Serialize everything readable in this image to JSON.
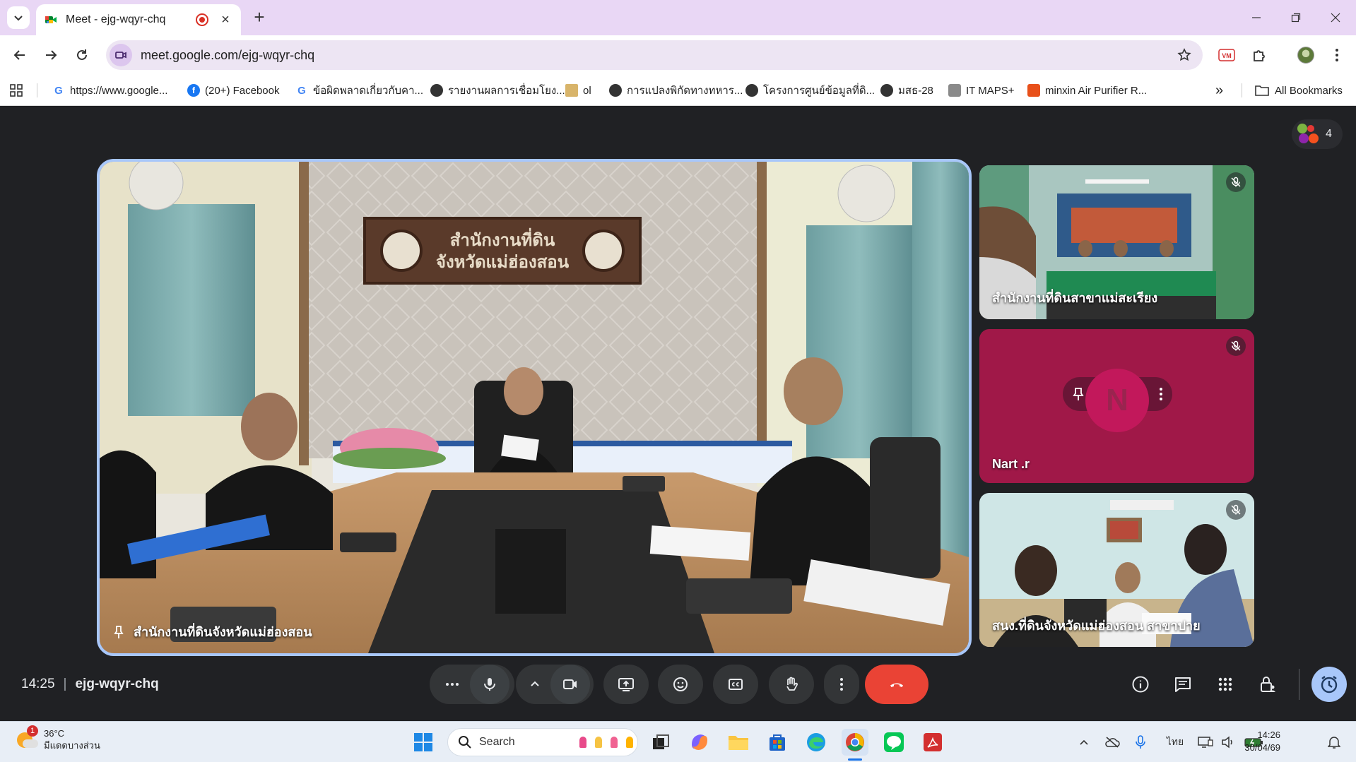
{
  "browser": {
    "tab_title": "Meet - ejg-wqyr-chq",
    "new_tab": "+",
    "close_tab": "×",
    "url": "meet.google.com/ejg-wqyr-chq",
    "bookmarks": [
      "https://www.google...",
      "(20+) Facebook",
      "ข้อผิดพลาดเกี่ยวกับคา...",
      "รายงานผลการเชื่อมโยง...",
      "ol",
      "การแปลงพิกัดทางทหาร...",
      "โครงการศูนย์ข้อมูลที่ดิ...",
      "มสธ-28",
      "IT MAPS+",
      "minxin Air Purifier R..."
    ],
    "more_bookmarks": "»",
    "all_bookmarks": "All Bookmarks"
  },
  "meet": {
    "participant_count": "4",
    "main_tile_label": "สำนักงานที่ดินจังหวัดแม่ฮ่องสอน",
    "sign_line1": "สำนักงานที่ดิน",
    "sign_line2": "จังหวัดแม่ฮ่องสอน",
    "tiles": [
      {
        "label": "สำนักงานที่ดินสาขาแม่สะเรียง",
        "muted": true
      },
      {
        "label": "Nart .r",
        "muted": true,
        "avatar_letter": "N",
        "avatar_color": "#c2185b"
      },
      {
        "label": "สนง.ที่ดินจังหวัดแม่ฮ่องสอน สาขาปาย",
        "muted": true
      }
    ],
    "time": "14:25",
    "meeting_code": "ejg-wqyr-chq",
    "leave_color": "#ea4335"
  },
  "taskbar": {
    "weather_temp": "36°C",
    "weather_desc": "มีแดดบางส่วน",
    "weather_badge": "1",
    "search_placeholder": "Search",
    "language": "ไทย",
    "clock_time": "14:26",
    "clock_date": "30/04/69"
  }
}
